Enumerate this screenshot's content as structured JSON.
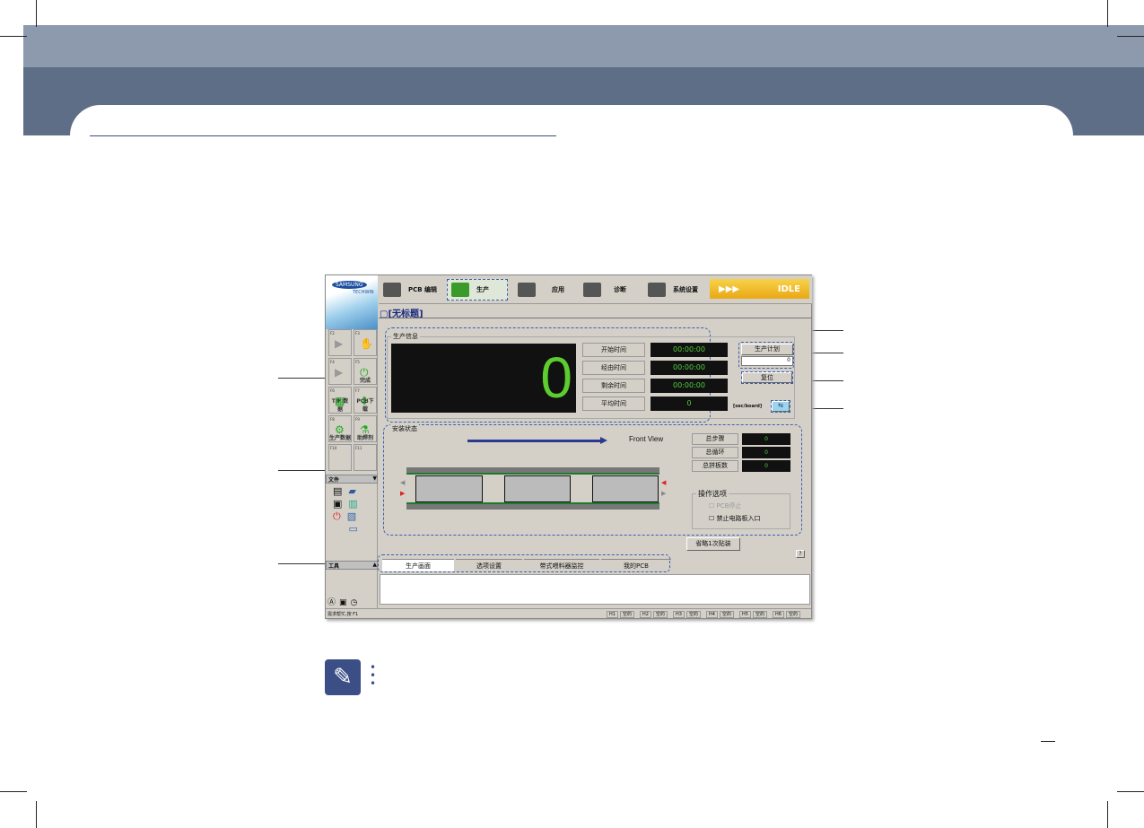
{
  "app": {
    "brand": "SAMSUNG",
    "brand_sub": "TECHWIN",
    "toolbar": [
      {
        "label": "PCB 编辑",
        "icon": "pcb-edit-icon"
      },
      {
        "label": "生产",
        "icon": "production-gear-icon"
      },
      {
        "label": "应用",
        "icon": "apply-icon"
      },
      {
        "label": "诊断",
        "icon": "diagnosis-icon"
      },
      {
        "label": "系统设置",
        "icon": "system-settings-icon"
      }
    ],
    "status_indicator": {
      "arrows": "▶▶▶",
      "text": "IDLE"
    },
    "doc_title": "[无标题]",
    "fkeys": [
      {
        "key": "F2",
        "label": "",
        "icon": "▶"
      },
      {
        "key": "F3",
        "label": "",
        "icon": "✋"
      },
      {
        "key": "F4",
        "label": "",
        "icon": "▶"
      },
      {
        "key": "F5",
        "label": "完成",
        "icon": "⏻"
      },
      {
        "key": "F6",
        "label": "T/F 数据",
        "icon": "▦"
      },
      {
        "key": "F7",
        "label": "PCB下载",
        "icon": "⬇"
      },
      {
        "key": "F8",
        "label": "生产数据",
        "icon": "⚙"
      },
      {
        "key": "F9",
        "label": "助焊剂",
        "icon": "⚗"
      },
      {
        "key": "F10",
        "label": "",
        "icon": ""
      },
      {
        "key": "F11",
        "label": "",
        "icon": ""
      }
    ],
    "file_panel": {
      "title": "文件",
      "arrow": "▼"
    },
    "tool_panel": {
      "title": "工具",
      "arrow": "▲"
    },
    "production_info": {
      "title": "生产信息",
      "count": "0",
      "rows": [
        {
          "label": "开始时间",
          "value": "00:00:00"
        },
        {
          "label": "经由时间",
          "value": "00:00:00"
        },
        {
          "label": "剩余时间",
          "value": "00:00:00"
        },
        {
          "label": "平均时间",
          "value": "0"
        }
      ],
      "plan_button": "生产计划",
      "plan_value": "0",
      "reset_button": "复位",
      "unit": "[sec/board]"
    },
    "mount_status": {
      "title": "安装状态",
      "view": "Front View",
      "counters": [
        {
          "label": "总步骤",
          "value": "0"
        },
        {
          "label": "总循环",
          "value": "0"
        },
        {
          "label": "总拼板数",
          "value": "0"
        }
      ],
      "options_title": "操作选项",
      "options": [
        {
          "label": "PCB停止",
          "checked": false,
          "disabled": true
        },
        {
          "label": "禁止电路板入口",
          "checked": false,
          "disabled": false
        }
      ]
    },
    "skip_button": "省略1次贴装",
    "help": "?",
    "tabs": [
      "生产画面",
      "选项设置",
      "带式喂料器监控",
      "我的PCB"
    ],
    "statusbar": {
      "hint": "需求帮忙,按 F1",
      "heads": [
        {
          "h": "H1",
          "v": "空的"
        },
        {
          "h": "H2",
          "v": "空的"
        },
        {
          "h": "H3",
          "v": "空的"
        },
        {
          "h": "H4",
          "v": "空的"
        },
        {
          "h": "H5",
          "v": "空的"
        },
        {
          "h": "H6",
          "v": "空的"
        }
      ]
    }
  }
}
